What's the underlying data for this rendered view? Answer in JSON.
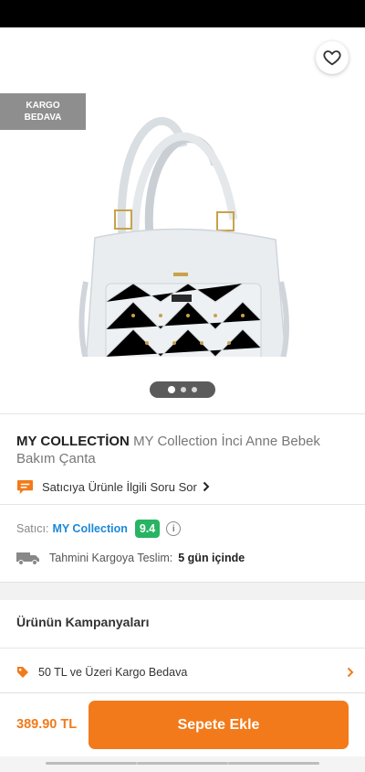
{
  "badge": {
    "line1": "KARGO",
    "line2": "BEDAVA"
  },
  "icons": {
    "back": "arrow-left-icon",
    "share": "share-icon",
    "favorite": "heart-icon"
  },
  "product": {
    "brand": "MY COLLECTİON",
    "name": "MY Collection İnci Anne Bebek Bakım Çanta",
    "image_count": 3,
    "active_image": 1
  },
  "question_link": "Satıcıya Ürünle İlgili Soru Sor",
  "seller": {
    "label": "Satıcı:",
    "name": "MY Collection",
    "score": "9.4"
  },
  "shipping": {
    "label": "Tahmini Kargoya Teslim:",
    "value": "5 gün içinde"
  },
  "campaigns": {
    "title": "Ürünün Kampanyaları",
    "items": [
      {
        "label": "50 TL ve Üzeri Kargo Bedava"
      }
    ]
  },
  "footer": {
    "price": "389.90 TL",
    "button": "Sepete Ekle"
  },
  "colors": {
    "accent": "#f27a1a",
    "score": "#28b463",
    "link": "#1c88d8",
    "badge": "#8e8e8e"
  }
}
